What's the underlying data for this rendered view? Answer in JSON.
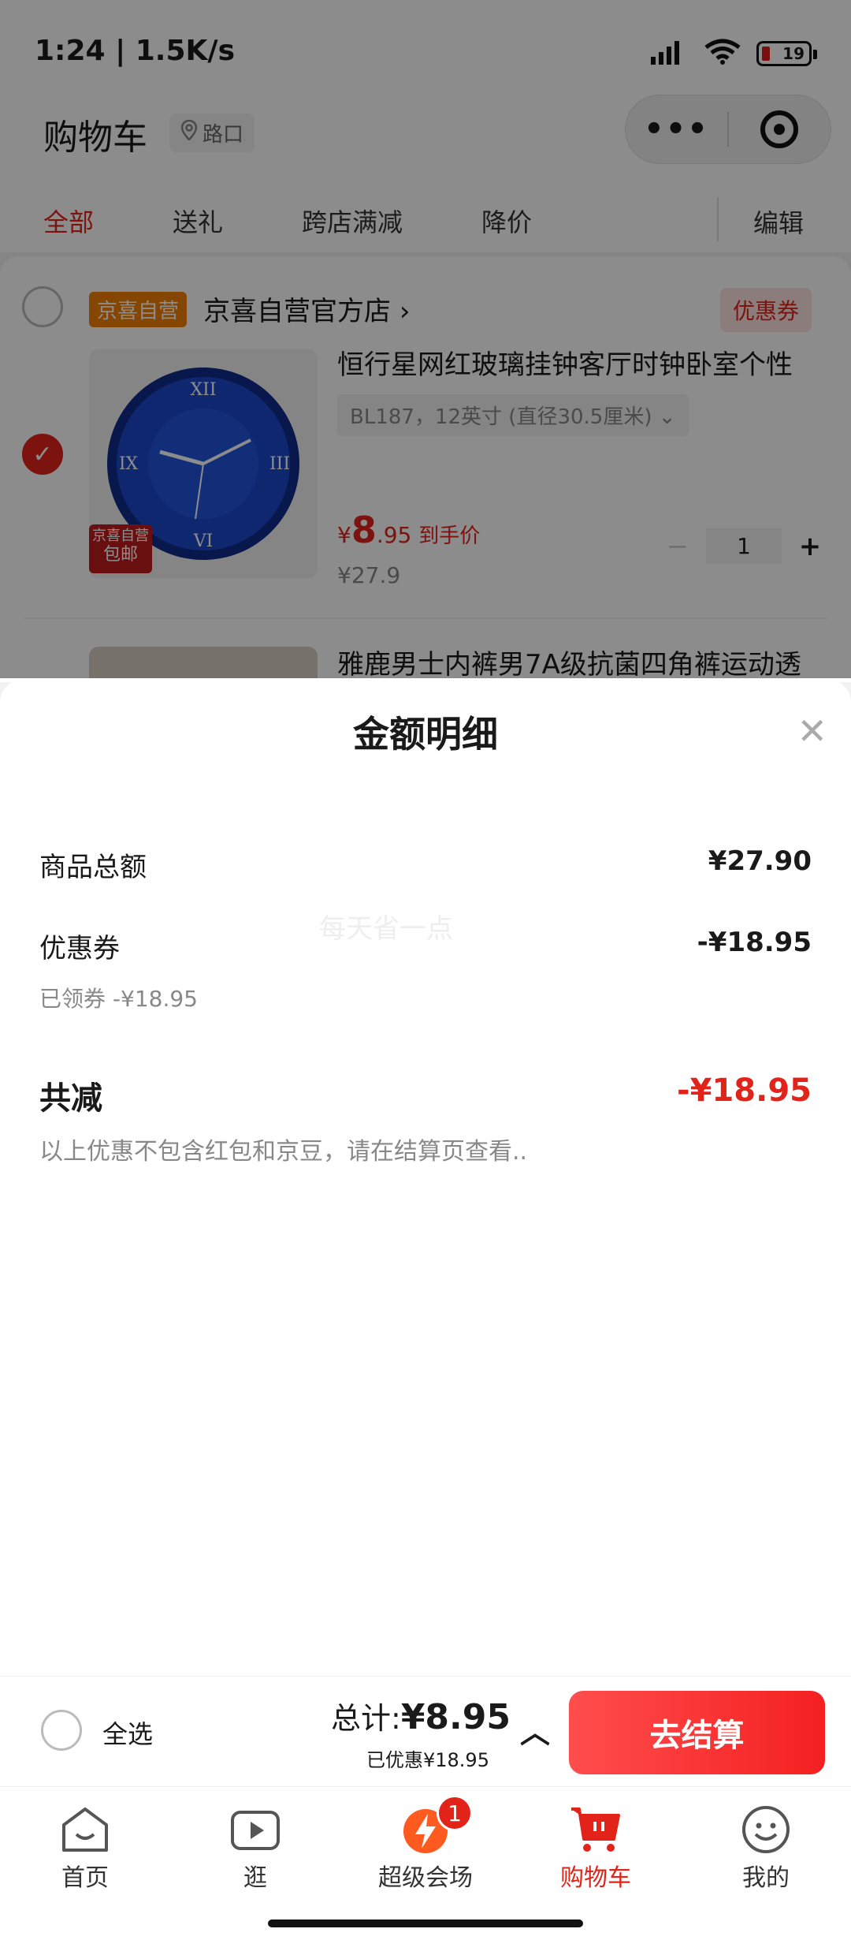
{
  "status": {
    "time": "1:24 | 1.5K/s",
    "battery": "19"
  },
  "header": {
    "title": "购物车",
    "location": "路口"
  },
  "tabs": {
    "all": "全部",
    "gift": "送礼",
    "cross_store": "跨店满减",
    "price_drop": "降价",
    "edit": "编辑"
  },
  "store": {
    "badge": "京喜自营",
    "name": "京喜自营官方店",
    "coupon": "优惠券",
    "item": {
      "title": "恒行星网红玻璃挂钟客厅时钟卧室个性",
      "spec": "BL187，12英寸 (直径30.5厘米)",
      "price_symbol": "¥",
      "price_int": "8",
      "price_dec": ".95",
      "price_tag": "到手价",
      "original_price": "¥27.9",
      "quantity": "1",
      "thumb_badge_line1": "京喜自营",
      "thumb_badge_line2": "包邮"
    },
    "item2": {
      "title": "雅鹿男士内裤男7A级抗菌四角裤运动透"
    }
  },
  "sheet": {
    "title": "金额明细",
    "goods_total_label": "商品总额",
    "goods_total_value": "¥27.90",
    "coupon_label": "优惠券",
    "coupon_value": "-¥18.95",
    "coupon_sub": "已领券 -¥18.95",
    "watermark": "每天省一点",
    "total_label": "共减",
    "total_value": "-¥18.95",
    "note": "以上优惠不包含红包和京豆，请在结算页查看.."
  },
  "checkout": {
    "select_all": "全选",
    "total_prefix": "总计:",
    "total_value": "¥8.95",
    "saved": "已优惠¥18.95",
    "pay_button": "去结算"
  },
  "nav": {
    "home": "首页",
    "browse": "逛",
    "super": "超级会场",
    "super_badge": "1",
    "cart": "购物车",
    "mine": "我的"
  },
  "colors": {
    "accent": "#e2231a",
    "store_badge": "#f08000"
  }
}
